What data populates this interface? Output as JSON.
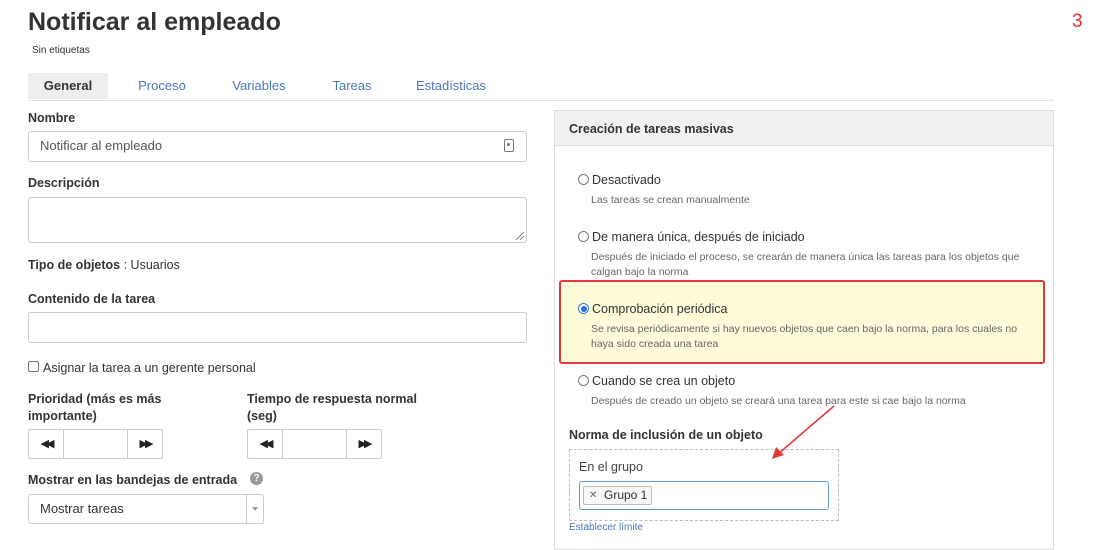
{
  "header": {
    "title": "Notificar al empleado",
    "tags": "Sin etiquetas",
    "corner_number": "3"
  },
  "tabs": [
    {
      "label": "General",
      "active": true
    },
    {
      "label": "Proceso",
      "active": false
    },
    {
      "label": "Variables",
      "active": false
    },
    {
      "label": "Tareas",
      "active": false
    },
    {
      "label": "Estadísticas",
      "active": false
    }
  ],
  "form": {
    "name_label": "Nombre",
    "name_value": "Notificar al empleado",
    "description_label": "Descripción",
    "object_type_label": "Tipo de objetos",
    "object_type_value": " : Usuarios",
    "task_content_label": "Contenido de la tarea",
    "assign_manager_label": "Asignar la tarea a un gerente personal",
    "priority_label": "Prioridad (más es más importante)",
    "response_time_label": "Tiempo de respuesta normal (seg)",
    "show_inbox_label": "Mostrar en las bandejas de entrada",
    "show_inbox_value": "Mostrar tareas",
    "help_glyph": "?"
  },
  "panel": {
    "title": "Creación de tareas masivas",
    "options": [
      {
        "label": "Desactivado",
        "desc": "Las tareas se crean manualmente",
        "selected": false
      },
      {
        "label": "De manera única, después de iniciado",
        "desc": "Después de iniciado el proceso, se crearán de manera única las tareas para los objetos que calgan bajo la norma",
        "selected": false
      },
      {
        "label": "Comprobación periódica",
        "desc": "Se revisa periódicamente si hay nuevos objetos que caen bajo la norma, para los cuales no haya sido creada una tarea",
        "selected": true
      },
      {
        "label": "Cuando se crea un objeto",
        "desc": "Después de creado un objeto se creará una tarea para este si cae bajo la norma",
        "selected": false
      }
    ],
    "rule_label": "Norma de inclusión de un objeto",
    "group_label": "En el grupo",
    "group_chip": "Grupo 1",
    "set_limit_link": "Establecer límite"
  },
  "colors": {
    "accent_link": "#4a78b8",
    "highlight_border": "#e03a3a",
    "highlight_fill": "#fefbd8",
    "annotation_arrow": "#e03a3a"
  }
}
